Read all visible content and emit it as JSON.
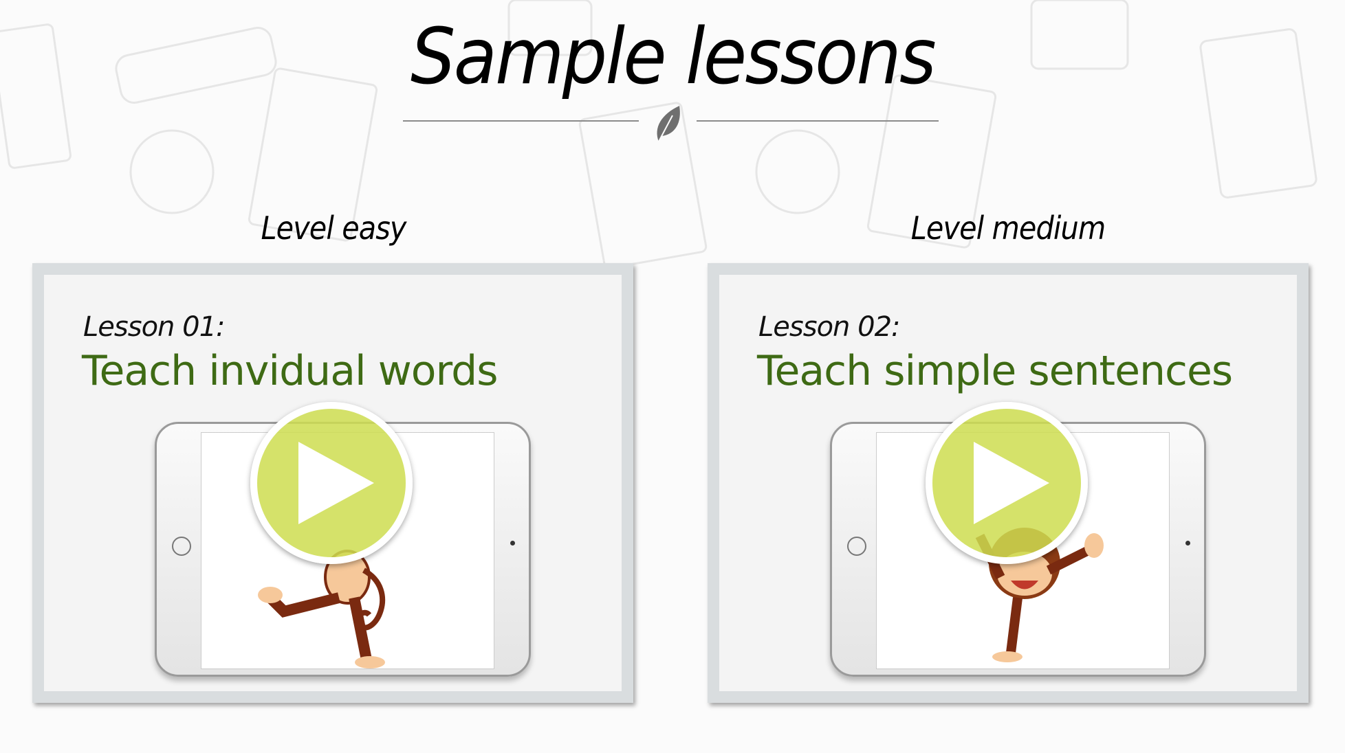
{
  "page": {
    "title": "Sample lessons"
  },
  "lessons": [
    {
      "level": "Level easy",
      "number": "Lesson 01:",
      "title": "Teach invidual words"
    },
    {
      "level": "Level medium",
      "number": "Lesson 02:",
      "title": "Teach simple sentences"
    }
  ],
  "colors": {
    "accent_green": "#3e6a14",
    "play_green": "#cedd50",
    "card_border": "#d9dddf"
  },
  "icons": {
    "divider": "leaf-icon",
    "play": "play-icon",
    "illustration": "monkey-illustration"
  }
}
